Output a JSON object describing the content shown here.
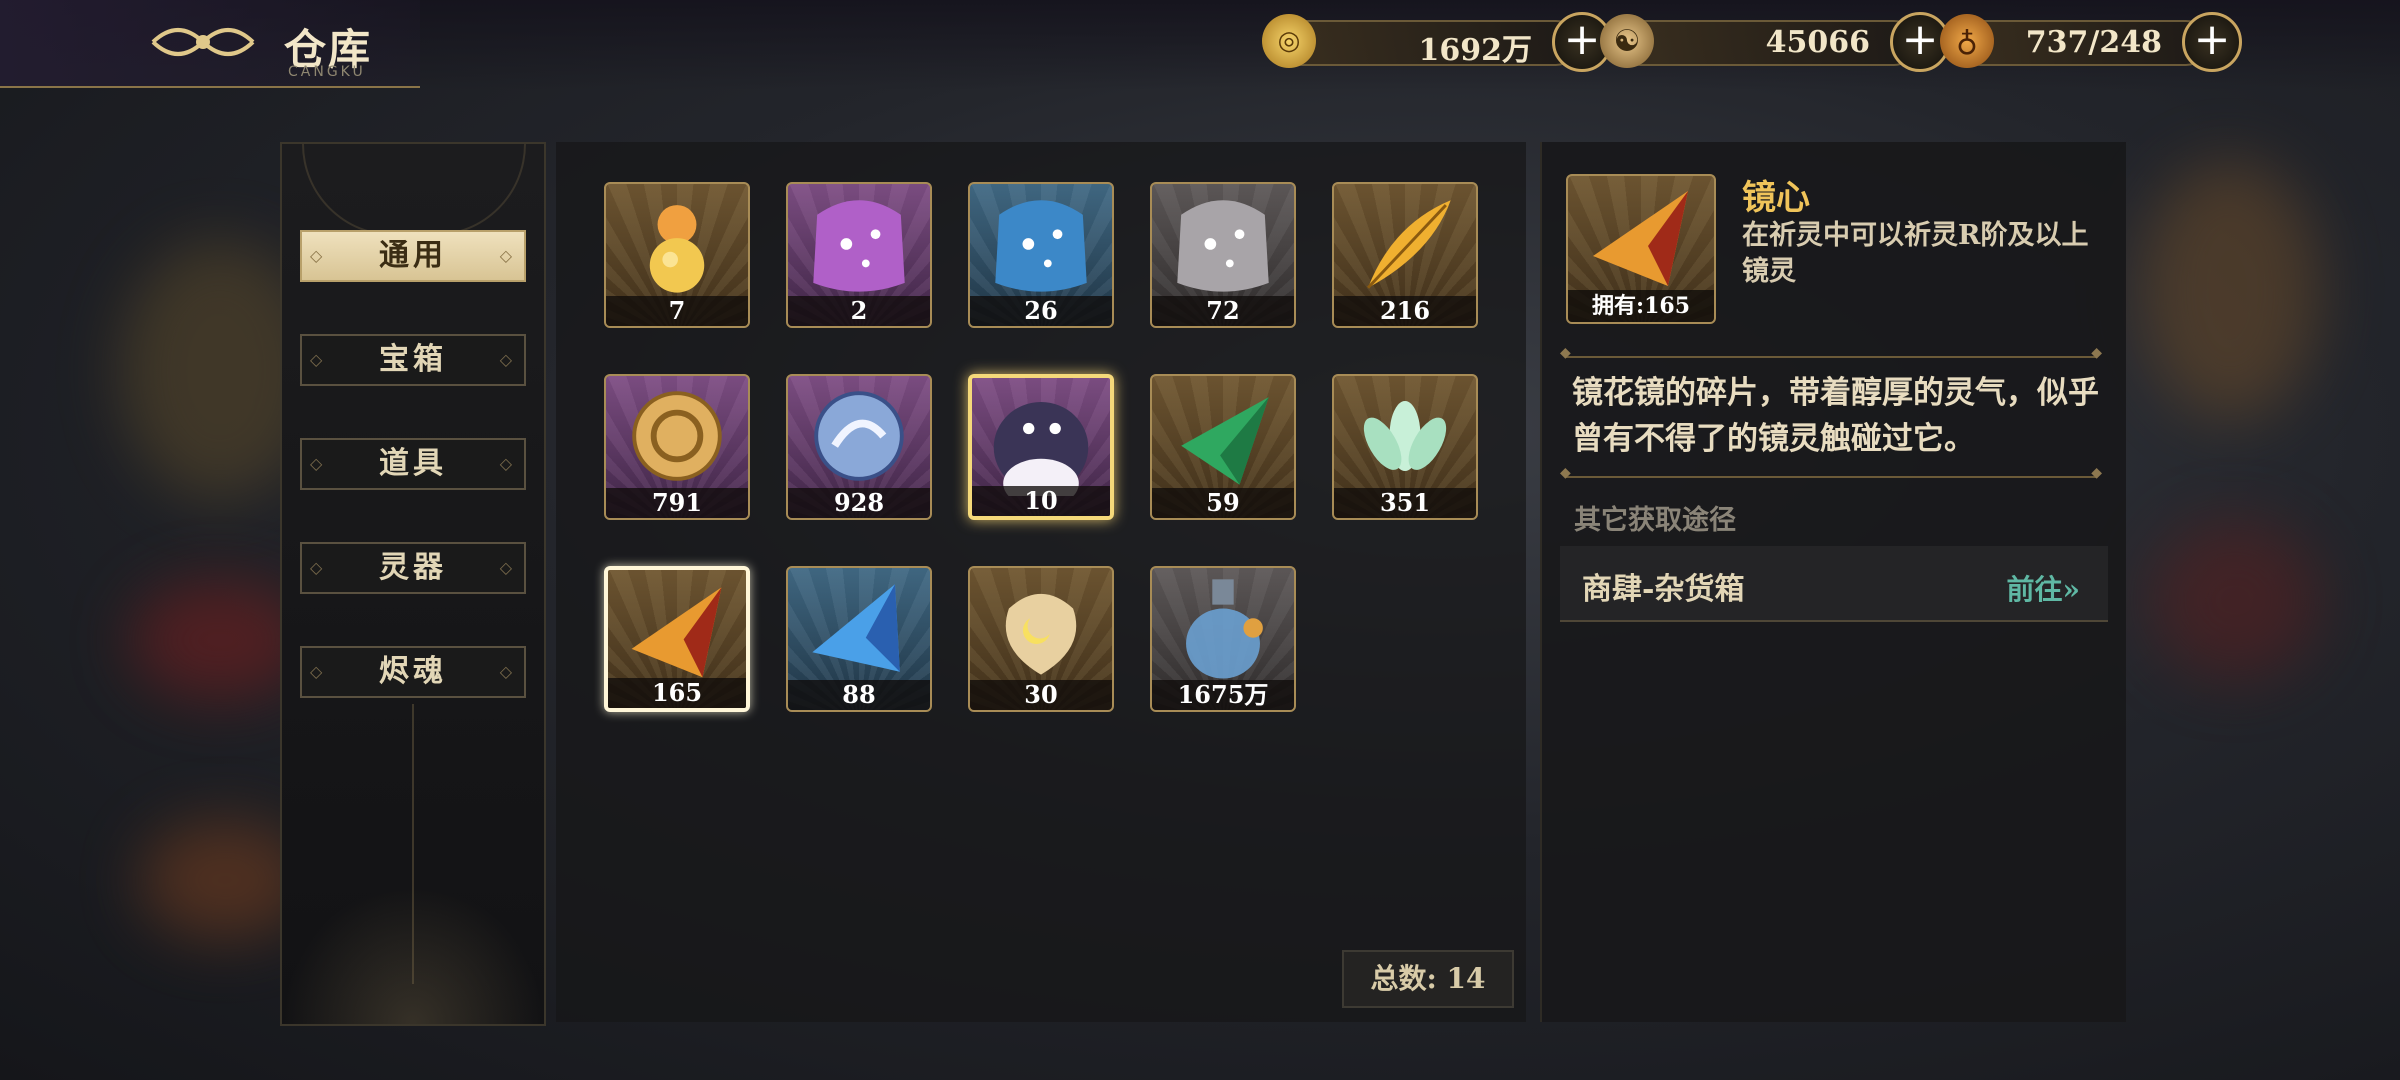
{
  "header": {
    "title": "仓库",
    "subtitle": "CANGKU"
  },
  "currencies": [
    {
      "icon": "gold-coin-icon",
      "value": "1692万"
    },
    {
      "icon": "dragon-jade-icon",
      "value": "45066"
    },
    {
      "icon": "gourd-stamina-icon",
      "value": "737/248"
    }
  ],
  "categories": [
    {
      "label": "通用",
      "active": true
    },
    {
      "label": "宝箱",
      "active": false
    },
    {
      "label": "道具",
      "active": false
    },
    {
      "label": "灵器",
      "active": false
    },
    {
      "label": "烬魂",
      "active": false
    }
  ],
  "items": [
    {
      "icon": "golden-gourd-icon",
      "count": "7",
      "rarity": "gold"
    },
    {
      "icon": "purple-treasure-pouch-icon",
      "count": "2",
      "rarity": "purple"
    },
    {
      "icon": "blue-treasure-pouch-icon",
      "count": "26",
      "rarity": "blue"
    },
    {
      "icon": "silver-treasure-pouch-icon",
      "count": "72",
      "rarity": "grey"
    },
    {
      "icon": "golden-feather-icon",
      "count": "216",
      "rarity": "gold"
    },
    {
      "icon": "golden-triskelion-token-icon",
      "count": "791",
      "rarity": "purple"
    },
    {
      "icon": "blue-beast-token-icon",
      "count": "928",
      "rarity": "purple"
    },
    {
      "icon": "dark-spirit-blob-icon",
      "count": "10",
      "rarity": "purple"
    },
    {
      "icon": "green-crystal-shard-icon",
      "count": "59",
      "rarity": "gold"
    },
    {
      "icon": "jade-lotus-icon",
      "count": "351",
      "rarity": "gold"
    },
    {
      "icon": "mirror-heart-shard-icon",
      "count": "165",
      "rarity": "gold"
    },
    {
      "icon": "blue-crystal-shard-icon",
      "count": "88",
      "rarity": "blue"
    },
    {
      "icon": "moon-amber-stone-icon",
      "count": "30",
      "rarity": "gold"
    },
    {
      "icon": "spirit-potion-bottle-icon",
      "count": "1675万",
      "rarity": "grey"
    }
  ],
  "total_label": "总数: 14",
  "detail": {
    "name": "镜心",
    "own_label": "拥有:165",
    "description": "在祈灵中可以祈灵R阶及以上镜灵",
    "flavor": "镜花镜的碎片，带着醇厚的灵气，似乎曾有不得了的镜灵触碰过它。",
    "other_sources_label": "其它获取途径",
    "source_name": "商肆-杂货箱",
    "go_label": "前往»"
  }
}
